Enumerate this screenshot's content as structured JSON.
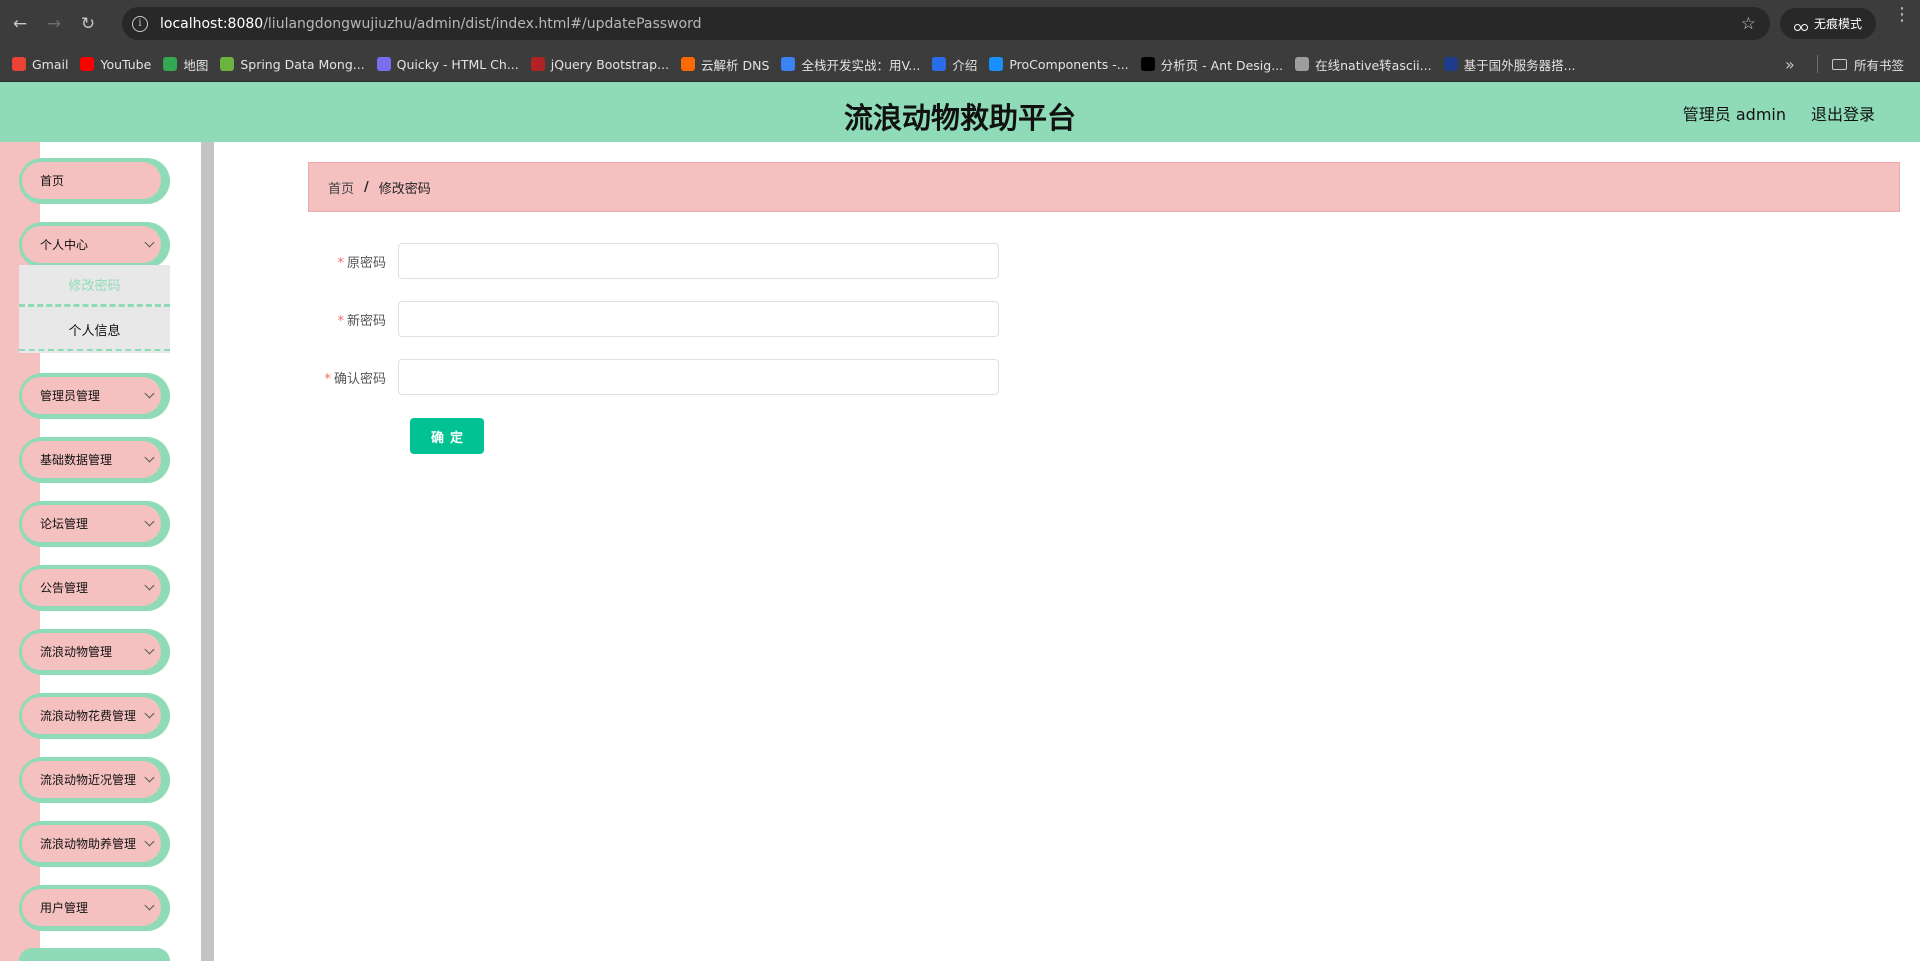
{
  "browser": {
    "url_host": "localhost:8080",
    "url_path": "/liulangdongwujiuzhu/admin/dist/index.html#/updatePassword",
    "incognito_label": "无痕模式",
    "bookmarks": [
      {
        "label": "Gmail",
        "color": "#ea4335"
      },
      {
        "label": "YouTube",
        "color": "#ff0000"
      },
      {
        "label": "地图",
        "color": "#34a853"
      },
      {
        "label": "Spring Data Mong...",
        "color": "#6db33f"
      },
      {
        "label": "Quicky - HTML Ch...",
        "color": "#7c6cf0"
      },
      {
        "label": "jQuery Bootstrap...",
        "color": "#b22222"
      },
      {
        "label": "云解析 DNS",
        "color": "#ff6a00"
      },
      {
        "label": "全栈开发实战：用V...",
        "color": "#3b82f6"
      },
      {
        "label": "介绍",
        "color": "#2b6de8"
      },
      {
        "label": "ProComponents -...",
        "color": "#1890ff"
      },
      {
        "label": "分析页 - Ant Desig...",
        "color": "#000000"
      },
      {
        "label": "在线native转ascii...",
        "color": "#9e9e9e"
      },
      {
        "label": "基于国外服务器搭...",
        "color": "#1e3a8a"
      }
    ],
    "all_bookmarks_label": "所有书签"
  },
  "header": {
    "title": "流浪动物救助平台",
    "user": "管理员 admin",
    "logout": "退出登录"
  },
  "sidebar": {
    "items": [
      {
        "label": "首页",
        "has_children": false
      },
      {
        "label": "个人中心",
        "has_children": true
      },
      {
        "label": "管理员管理",
        "has_children": true
      },
      {
        "label": "基础数据管理",
        "has_children": true
      },
      {
        "label": "论坛管理",
        "has_children": true
      },
      {
        "label": "公告管理",
        "has_children": true
      },
      {
        "label": "流浪动物管理",
        "has_children": true
      },
      {
        "label": "流浪动物花费管理",
        "has_children": true
      },
      {
        "label": "流浪动物近况管理",
        "has_children": true
      },
      {
        "label": "流浪动物助养管理",
        "has_children": true
      },
      {
        "label": "用户管理",
        "has_children": true
      }
    ],
    "submenu": {
      "active": "修改密码",
      "other": "个人信息"
    }
  },
  "breadcrumb": {
    "home": "首页",
    "separator": "/",
    "current": "修改密码"
  },
  "form": {
    "fields": [
      {
        "label": "原密码",
        "value": ""
      },
      {
        "label": "新密码",
        "value": ""
      },
      {
        "label": "确认密码",
        "value": ""
      }
    ],
    "submit": "确定"
  },
  "colors": {
    "header_bg": "#8fdbb8",
    "sidebar_pink": "#f5c0c0",
    "primary_button": "#00c292",
    "required_mark": "#f56c6c"
  }
}
